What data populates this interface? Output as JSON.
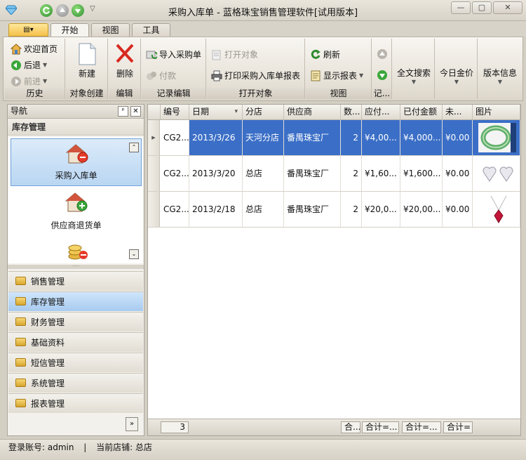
{
  "window": {
    "title": "采购入库单 - 蓝格珠宝销售管理软件[试用版本]",
    "quick_access_more": "▽",
    "minimize": "—",
    "maximize": "▢",
    "close": "✕"
  },
  "ribbon": {
    "app_menu": "▤▾",
    "tabs": [
      {
        "label": "开始",
        "active": true
      },
      {
        "label": "视图",
        "active": false
      },
      {
        "label": "工具",
        "active": false
      }
    ],
    "groups": {
      "history": {
        "label": "历史",
        "home": "欢迎首页",
        "back": "后退",
        "forward": "前进"
      },
      "create": {
        "label": "对象创建",
        "new": "新建"
      },
      "edit": {
        "label": "编辑",
        "delete": "删除"
      },
      "record_edit": {
        "label": "记录编辑",
        "import": "导入采购单",
        "pay": "付款"
      },
      "open_object": {
        "label": "打开对象",
        "open": "打开对象",
        "print": "打印采购入库单报表"
      },
      "view": {
        "label": "视图",
        "refresh": "刷新",
        "show_report": "显示报表"
      },
      "record_nav": {
        "label": "记..."
      },
      "fulltext": {
        "label": "全文搜索"
      },
      "gold_price": {
        "label": "今日金价"
      },
      "version": {
        "label": "版本信息"
      }
    }
  },
  "nav": {
    "title": "导航",
    "pin": "ᵖ",
    "close": "✕",
    "section": "库存管理",
    "items": [
      {
        "label": "采购入库单",
        "selected": true
      },
      {
        "label": "供应商退货单",
        "selected": false
      },
      {
        "label": "",
        "selected": false
      }
    ],
    "scroll_up": "⌃",
    "scroll_down": "⌄",
    "splitter": "·····",
    "modules": [
      {
        "label": "销售管理",
        "active": false
      },
      {
        "label": "库存管理",
        "active": true
      },
      {
        "label": "财务管理",
        "active": false
      },
      {
        "label": "基础资料",
        "active": false
      },
      {
        "label": "短信管理",
        "active": false
      },
      {
        "label": "系统管理",
        "active": false
      },
      {
        "label": "报表管理",
        "active": false
      }
    ],
    "footer_button": "»"
  },
  "grid": {
    "columns": [
      "编号",
      "日期",
      "分店",
      "供应商",
      "数...",
      "应付...",
      "已付金额",
      "未...",
      "图片"
    ],
    "rows": [
      {
        "code": "CG2...",
        "date": "2013/3/26",
        "branch": "天河分店",
        "supplier": "番禺珠宝厂",
        "qty": "2",
        "payable": "¥4,00...",
        "paid": "¥4,000...",
        "unpaid": "¥0.00",
        "image": "jade-bangle"
      },
      {
        "code": "CG2...",
        "date": "2013/3/20",
        "branch": "总店",
        "supplier": "番禺珠宝厂",
        "qty": "2",
        "payable": "¥1,60...",
        "paid": "¥1,600...",
        "unpaid": "¥0.00",
        "image": "heart-earrings"
      },
      {
        "code": "CG2...",
        "date": "2013/2/18",
        "branch": "总店",
        "supplier": "番禺珠宝厂",
        "qty": "2",
        "payable": "¥20,0...",
        "paid": "¥20,00...",
        "unpaid": "¥0.00",
        "image": "ruby-pendant"
      }
    ],
    "totals": {
      "count": "3",
      "qty_sum": "合...",
      "payable_sum": "合计=...",
      "paid_sum": "合计=...",
      "unpaid_sum": "合计="
    },
    "sort_indicator": "▾",
    "selected_color": "#3b6fc7"
  },
  "status": {
    "account": "登录账号: admin",
    "separator": "|",
    "store": "当前店铺: 总店"
  }
}
